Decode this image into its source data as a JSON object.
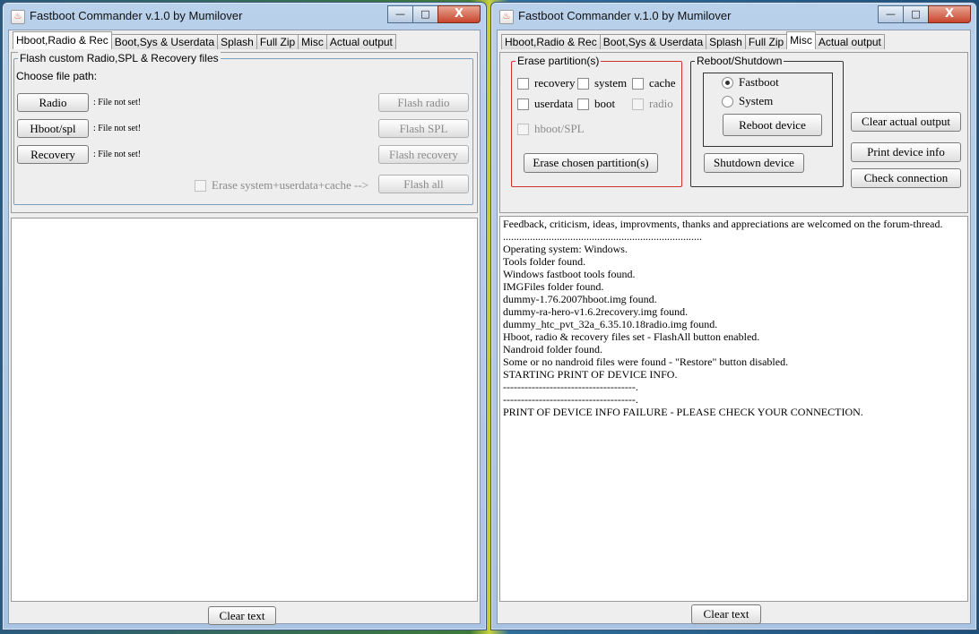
{
  "left": {
    "title": "Fastboot Commander v.1.0 by Mumilover",
    "tabs": [
      "Hboot,Radio & Rec",
      "Boot,Sys & Userdata",
      "Splash",
      "Full Zip",
      "Misc",
      "Actual output"
    ],
    "active_tab": 0,
    "group_title": "Flash custom Radio,SPL & Recovery files",
    "choose_label": "Choose file path:",
    "rows": [
      {
        "button": "Radio",
        "status": ": File not set!",
        "flash": "Flash radio"
      },
      {
        "button": "Hboot/spl",
        "status": ": File not set!",
        "flash": "Flash SPL"
      },
      {
        "button": "Recovery",
        "status": ": File not set!",
        "flash": "Flash recovery"
      }
    ],
    "erase_all_label": "Erase system+userdata+cache  -->",
    "flash_all": "Flash all",
    "clear_text": "Clear text"
  },
  "right": {
    "title": "Fastboot Commander v.1.0 by Mumilover",
    "tabs": [
      "Hboot,Radio & Rec",
      "Boot,Sys & Userdata",
      "Splash",
      "Full Zip",
      "Misc",
      "Actual output"
    ],
    "active_tab": 4,
    "erase_group": {
      "title": "Erase partition(s)",
      "checkboxes": [
        "recovery",
        "system",
        "cache",
        "userdata",
        "boot",
        "radio",
        "hboot/SPL"
      ],
      "button": "Erase chosen partition(s)"
    },
    "reboot_group": {
      "title": "Reboot/Shutdown",
      "radios": [
        "Fastboot",
        "System"
      ],
      "reboot_button": "Reboot device",
      "shutdown_button": "Shutdown device"
    },
    "side_buttons": [
      "Clear actual output",
      "Print device info",
      "Check connection"
    ],
    "output_lines": [
      "Feedback, criticism, ideas, improvments, thanks and appreciations are welcomed on the forum-thread.",
      "..........................................................................",
      "Operating system: Windows.",
      "Tools folder found.",
      "Windows fastboot tools found.",
      "IMGFiles folder found.",
      "dummy-1.76.2007hboot.img found.",
      "dummy-ra-hero-v1.6.2recovery.img found.",
      "dummy_htc_pvt_32a_6.35.10.18radio.img found.",
      "Hboot, radio & recovery files set - FlashAll button enabled.",
      "Nandroid folder found.",
      "Some or no nandroid files were found - \"Restore\" button disabled.",
      "STARTING PRINT OF DEVICE INFO.",
      "-------------------------------------.",
      "-------------------------------------.",
      "PRINT OF DEVICE INFO FAILURE - PLEASE CHECK YOUR CONNECTION."
    ],
    "clear_text": "Clear text"
  },
  "window_buttons": {
    "minimize": "—",
    "maximize": "□",
    "close": "X"
  }
}
